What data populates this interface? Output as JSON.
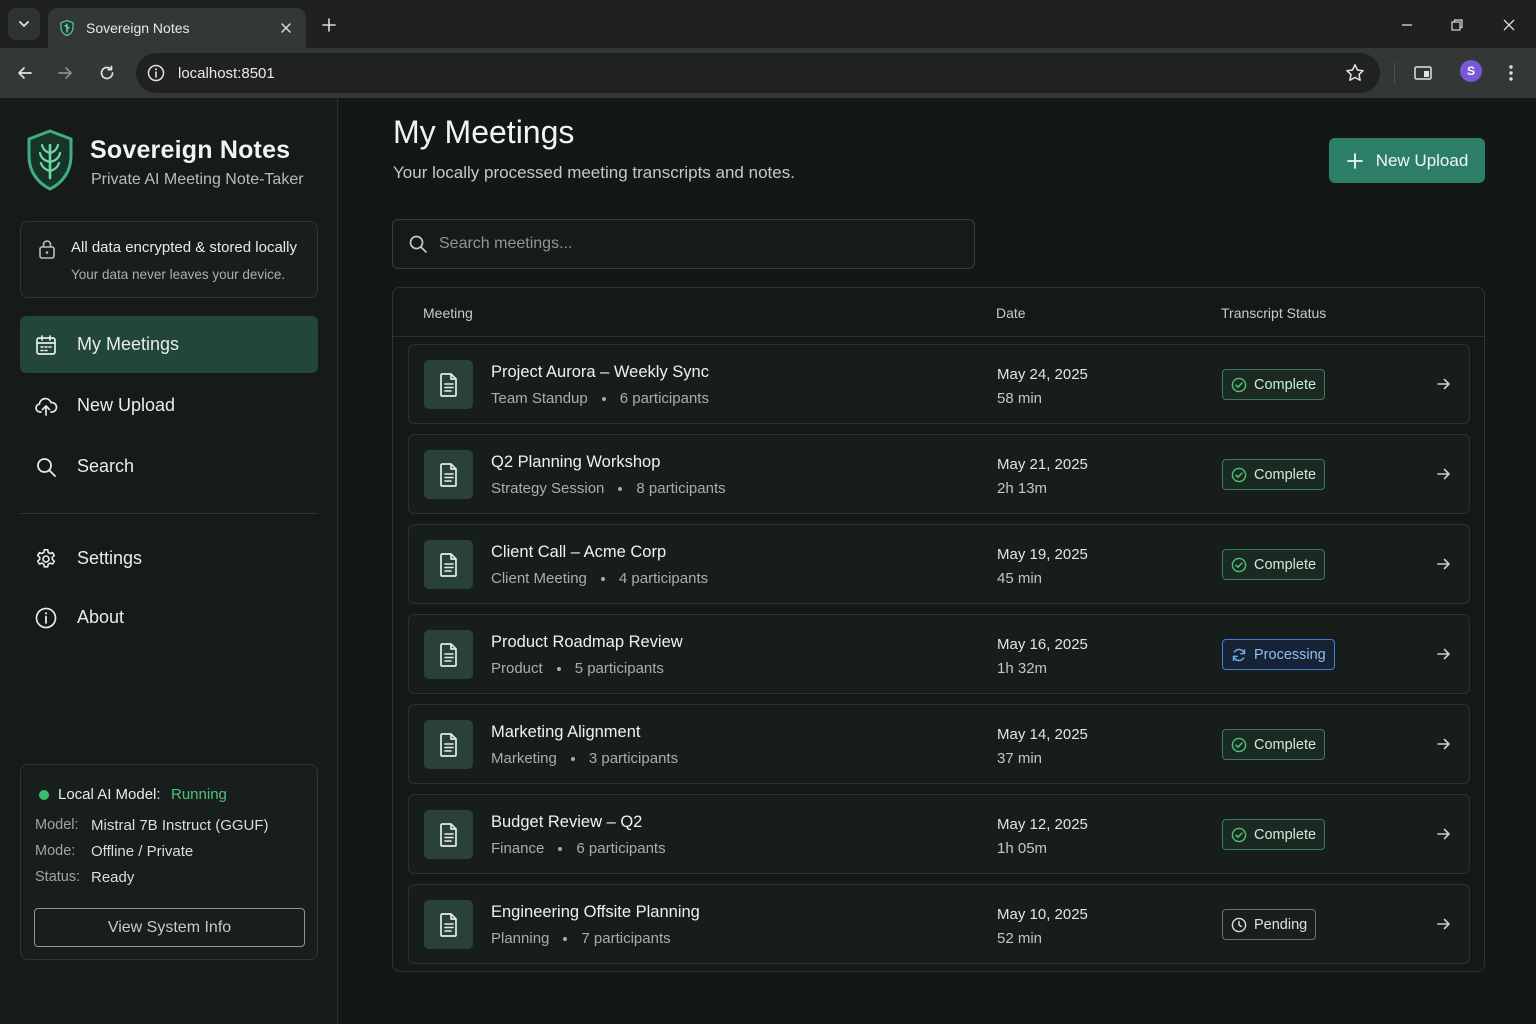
{
  "browser": {
    "tab_title": "Sovereign Notes",
    "url": "localhost:8501",
    "profile_initial": "S"
  },
  "brand": {
    "title": "Sovereign Notes",
    "subtitle": "Private AI Meeting Note-Taker"
  },
  "privacy": {
    "title": "All data encrypted & stored locally",
    "subtitle": "Your data never leaves your device."
  },
  "nav": {
    "my_meetings": "My Meetings",
    "new_upload": "New Upload",
    "search": "Search",
    "settings": "Settings",
    "about": "About"
  },
  "model": {
    "label": "Local AI Model:",
    "state": "Running",
    "model_key": "Model:",
    "model_val": "Mistral 7B Instruct (GGUF)",
    "mode_key": "Mode:",
    "mode_val": "Offline / Private",
    "status_key": "Status:",
    "status_val": "Ready",
    "button": "View System Info"
  },
  "header": {
    "title": "My Meetings",
    "subtitle": "Your locally processed meeting transcripts and notes.",
    "upload_button": "New Upload"
  },
  "search": {
    "placeholder": "Search meetings..."
  },
  "table": {
    "headers": {
      "meeting": "Meeting",
      "date": "Date",
      "status": "Transcript Status"
    },
    "rows": [
      {
        "title": "Project Aurora – Weekly Sync",
        "type": "Team Standup",
        "participants": "6 participants",
        "date": "May 24, 2025",
        "duration": "58 min",
        "status": "Complete",
        "status_kind": "complete"
      },
      {
        "title": "Q2 Planning Workshop",
        "type": "Strategy Session",
        "participants": "8 participants",
        "date": "May 21, 2025",
        "duration": "2h 13m",
        "status": "Complete",
        "status_kind": "complete"
      },
      {
        "title": "Client Call – Acme Corp",
        "type": "Client Meeting",
        "participants": "4 participants",
        "date": "May 19, 2025",
        "duration": "45 min",
        "status": "Complete",
        "status_kind": "complete"
      },
      {
        "title": "Product Roadmap Review",
        "type": "Product",
        "participants": "5 participants",
        "date": "May 16, 2025",
        "duration": "1h 32m",
        "status": "Processing",
        "status_kind": "processing"
      },
      {
        "title": "Marketing Alignment",
        "type": "Marketing",
        "participants": "3 participants",
        "date": "May 14, 2025",
        "duration": "37 min",
        "status": "Complete",
        "status_kind": "complete"
      },
      {
        "title": "Budget Review – Q2",
        "type": "Finance",
        "participants": "6 participants",
        "date": "May 12, 2025",
        "duration": "1h 05m",
        "status": "Complete",
        "status_kind": "complete"
      },
      {
        "title": "Engineering Offsite Planning",
        "type": "Planning",
        "participants": "7 participants",
        "date": "May 10, 2025",
        "duration": "52 min",
        "status": "Pending",
        "status_kind": "pending"
      }
    ]
  },
  "colors": {
    "accent": "#2c7f66",
    "active_nav": "#22463c",
    "complete": "#3b7b5b",
    "processing": "#3f7fd6",
    "running": "#37c06b"
  },
  "icons": {
    "logo": "shield-leaf-icon",
    "lock": "lock-icon",
    "meetings": "calendar-icon",
    "upload": "cloud-upload-icon",
    "search": "search-icon",
    "settings": "gear-icon",
    "about": "info-icon",
    "document": "document-icon",
    "complete": "check-circle-icon",
    "processing": "refresh-icon",
    "pending": "clock-icon",
    "open": "arrow-right-icon"
  }
}
